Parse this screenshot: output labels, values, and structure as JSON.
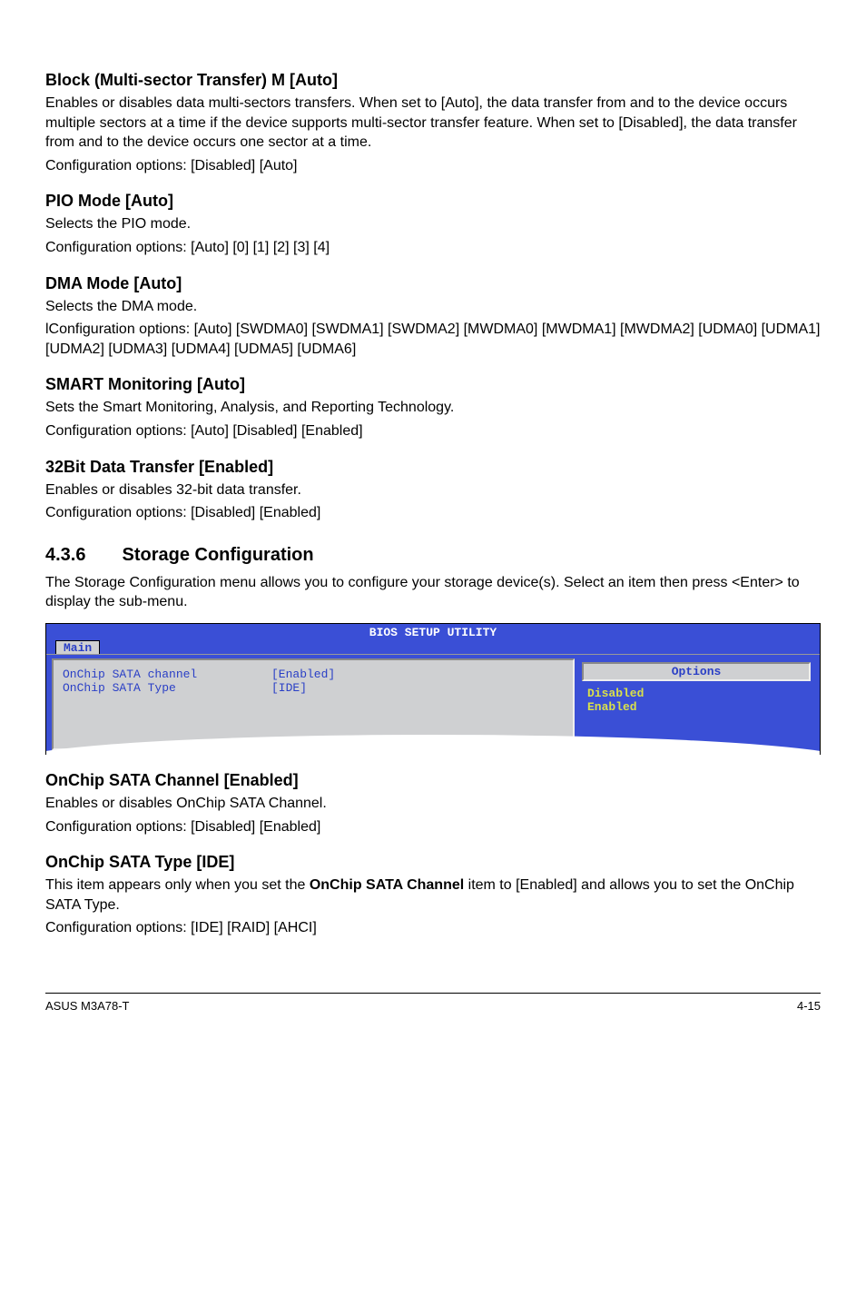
{
  "sections": {
    "block": {
      "heading": "Block (Multi-sector Transfer) M [Auto]",
      "body": "Enables or disables data multi-sectors transfers. When set to [Auto], the data transfer from and to the device occurs multiple sectors at a time if the device supports multi-sector transfer feature. When set to [Disabled], the data transfer from and to the device occurs one sector at a time.",
      "config": "Configuration options: [Disabled] [Auto]"
    },
    "pio": {
      "heading": "PIO Mode [Auto]",
      "body": "Selects the PIO mode.",
      "config": "Configuration options: [Auto] [0] [1] [2] [3] [4]"
    },
    "dma": {
      "heading": "DMA Mode [Auto]",
      "body": "Selects the DMA mode.",
      "config": "lConfiguration options: [Auto] [SWDMA0] [SWDMA1] [SWDMA2] [MWDMA0] [MWDMA1] [MWDMA2] [UDMA0] [UDMA1] [UDMA2] [UDMA3] [UDMA4] [UDMA5] [UDMA6]"
    },
    "smart": {
      "heading": "SMART Monitoring [Auto]",
      "body": "Sets the Smart Monitoring, Analysis, and Reporting Technology.",
      "config": "Configuration options: [Auto] [Disabled] [Enabled]"
    },
    "bit32": {
      "heading": "32Bit Data Transfer [Enabled]",
      "body": "Enables or disables 32-bit data transfer.",
      "config": "Configuration options: [Disabled] [Enabled]"
    },
    "storage": {
      "number": "4.3.6",
      "title": "Storage Configuration",
      "body": "The Storage Configuration menu allows you to configure your storage device(s). Select an item then press <Enter> to display the sub-menu."
    },
    "onchip_channel": {
      "heading": "OnChip SATA Channel [Enabled]",
      "body": "Enables or disables OnChip SATA Channel.",
      "config": "Configuration options: [Disabled] [Enabled]"
    },
    "onchip_type": {
      "heading": "OnChip SATA Type [IDE]",
      "body_pre": "This item appears only when you set the ",
      "body_bold": "OnChip SATA Channel",
      "body_post": " item to [Enabled] and allows you to set the OnChip SATA Type.",
      "config": "Configuration options: [IDE] [RAID] [AHCI]"
    }
  },
  "bios": {
    "title": "BIOS SETUP UTILITY",
    "tab": "Main",
    "rows": [
      {
        "label": "OnChip SATA channel",
        "value": "[Enabled]"
      },
      {
        "label": "OnChip SATA Type",
        "value": "[IDE]"
      }
    ],
    "options_header": "Options",
    "options": [
      "Disabled",
      "Enabled"
    ]
  },
  "footer": {
    "left": "ASUS M3A78-T",
    "right": "4-15"
  }
}
